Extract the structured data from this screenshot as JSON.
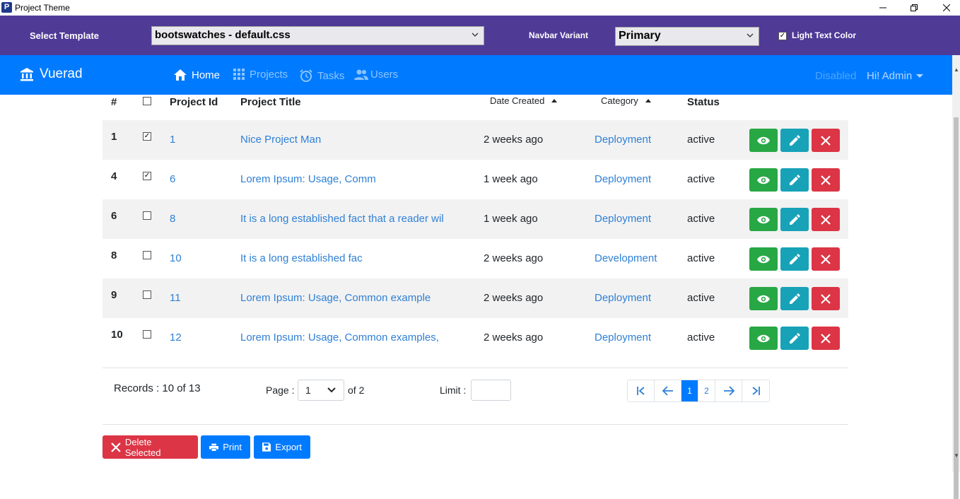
{
  "window": {
    "title": "Project Theme",
    "app_icon_letter": "P"
  },
  "template_bar": {
    "select_template_label": "Select Template",
    "template_value": "bootswatches - default.css",
    "navbar_variant_label": "Navbar Variant",
    "navbar_variant_value": "Primary",
    "light_text_label": "Light Text Color",
    "light_text_checked": true
  },
  "navbar": {
    "brand": "Vuerad",
    "items": [
      {
        "label": "Home",
        "icon": "home-icon",
        "active": true
      },
      {
        "label": "Projects",
        "icon": "grid-icon",
        "active": false
      },
      {
        "label": "Tasks",
        "icon": "alarm-clock-icon",
        "active": false
      },
      {
        "label": "Users",
        "icon": "users-icon",
        "active": false
      }
    ],
    "disabled_label": "Disabled",
    "user_label": "Hi! Admin"
  },
  "table": {
    "headers": {
      "num": "#",
      "project_id": "Project Id",
      "project_title": "Project Title",
      "date_created": "Date Created",
      "category": "Category",
      "status": "Status"
    },
    "rows": [
      {
        "num": "1",
        "checked": true,
        "id": "1",
        "title": "Nice Project Man",
        "date": "2 weeks ago",
        "category": "Deployment",
        "status": "active"
      },
      {
        "num": "4",
        "checked": true,
        "id": "6",
        "title": "Lorem Ipsum: Usage, Comm",
        "date": "1 week ago",
        "category": "Deployment",
        "status": "active"
      },
      {
        "num": "6",
        "checked": false,
        "id": "8",
        "title": "It is a long established fact that a reader wil",
        "date": "1 week ago",
        "category": "Deployment",
        "status": "active"
      },
      {
        "num": "8",
        "checked": false,
        "id": "10",
        "title": "It is a long established fac",
        "date": "2 weeks ago",
        "category": "Development",
        "status": "active"
      },
      {
        "num": "9",
        "checked": false,
        "id": "11",
        "title": "Lorem Ipsum: Usage, Common example",
        "date": "2 weeks ago",
        "category": "Deployment",
        "status": "active"
      },
      {
        "num": "10",
        "checked": false,
        "id": "12",
        "title": "Lorem Ipsum: Usage, Common examples,",
        "date": "2 weeks ago",
        "category": "Deployment",
        "status": "active"
      }
    ]
  },
  "pagination": {
    "records_text": "Records : 10 of 13",
    "page_label": "Page :",
    "page_value": "1",
    "of_text": "of 2",
    "limit_label": "Limit :",
    "limit_value": "",
    "pages": [
      "1",
      "2"
    ],
    "current_page": "1"
  },
  "actions": {
    "delete_selected": "Delete Selected",
    "print": "Print",
    "export": "Export"
  },
  "colors": {
    "template_bar": "#4f3a96",
    "navbar": "#007bff",
    "view": "#28a745",
    "edit": "#17a2b8",
    "delete": "#dc3545",
    "link": "#2f80d6"
  }
}
